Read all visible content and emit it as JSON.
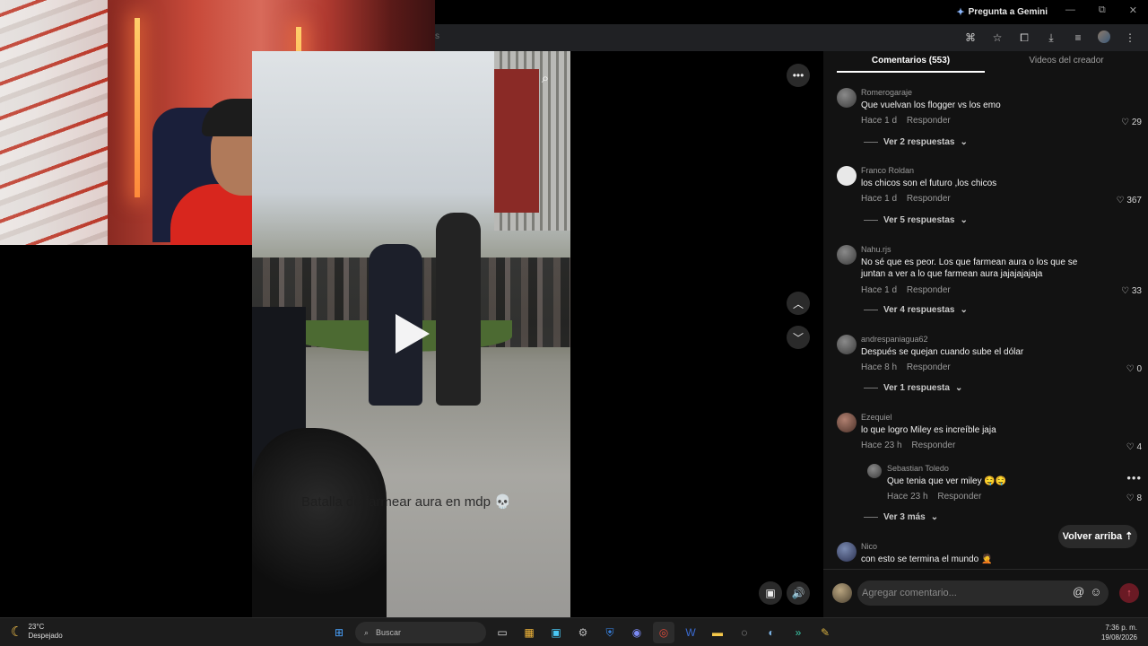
{
  "browser": {
    "gemini_label": "Pregunta a Gemini",
    "window_minimize": "—",
    "window_restore": "⧉",
    "window_close": "✕"
  },
  "video": {
    "caption": "Batalla de farmear aura en mdp 💀"
  },
  "comments_panel": {
    "tabs": [
      {
        "label": "Comentarios (553)",
        "active": true
      },
      {
        "label": "Videos del creador",
        "active": false
      }
    ],
    "comments": [
      {
        "user": "Romerogaraje",
        "text": "Que vuelvan los flogger vs los emo",
        "time": "Hace 1 d",
        "reply": "Responder",
        "likes": "29",
        "more": "Ver 2 respuestas"
      },
      {
        "user": "Franco Roldan",
        "text": "los chicos son el futuro ,los chicos",
        "time": "Hace 1 d",
        "reply": "Responder",
        "likes": "367",
        "more": "Ver 5 respuestas"
      },
      {
        "user": "Nahu.rjs",
        "text": "No sé que es peor. Los que farmean aura o los que se juntan a ver a lo que farmean aura jajajajajaja",
        "time": "Hace 1 d",
        "reply": "Responder",
        "likes": "33",
        "more": "Ver 4 respuestas"
      },
      {
        "user": "andrespaniagua62",
        "text": "Después se quejan cuando sube el dólar",
        "time": "Hace 8 h",
        "reply": "Responder",
        "likes": "0",
        "more": "Ver 1 respuesta"
      },
      {
        "user": "Ezequiel",
        "text": "lo que logro Miley es increíble jaja",
        "time": "Hace 23 h",
        "reply": "Responder",
        "likes": "4",
        "more": "Ver 3 más"
      },
      {
        "user": "Nico",
        "text": "con esto se termina el mundo 🤦"
      }
    ],
    "nested_reply": {
      "user": "Sebastian Toledo",
      "text": "Que tenia que ver miley 🤤🤤",
      "time": "Hace 23 h",
      "reply": "Responder",
      "likes": "8"
    },
    "back_to_top": "Volver arriba",
    "composer_placeholder": "Agregar comentario..."
  },
  "taskbar": {
    "temperature": "23°C",
    "condition": "Despejado",
    "search_label": "Buscar",
    "time": "7:36 p. m.",
    "date": "19/08/2026"
  },
  "colors": {
    "panel_bg": "#121212",
    "send_button": "#6a1a24",
    "taskbar_bg": "#1c1c1c"
  }
}
